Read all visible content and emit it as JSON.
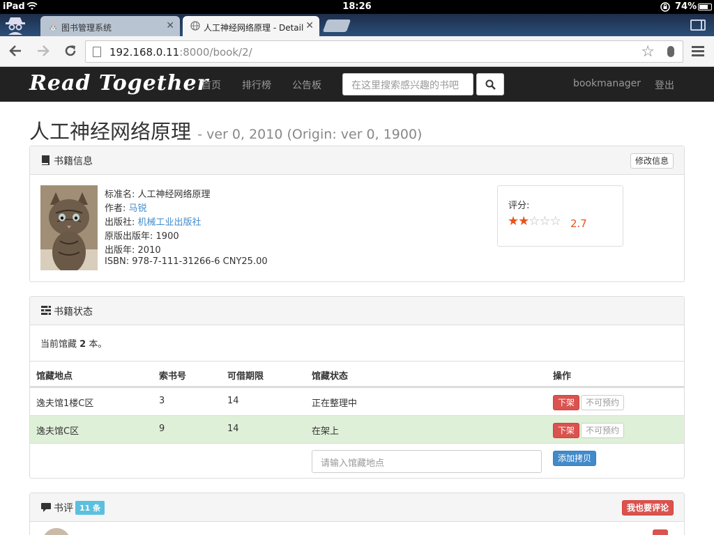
{
  "status_bar": {
    "carrier": "iPad",
    "time": "18:26",
    "battery": "74%"
  },
  "browser": {
    "tabs": [
      {
        "title": "图书管理系统",
        "active": false
      },
      {
        "title": "人工神经网络原理 - Detail",
        "active": true
      }
    ],
    "url_host": "192.168.0.11",
    "url_rest": ":8000/book/2/"
  },
  "navbar": {
    "brand": "Read Together",
    "links": [
      "首页",
      "排行榜",
      "公告板"
    ],
    "search_placeholder": "在这里搜索感兴趣的书吧",
    "user": "bookmanager",
    "logout": "登出"
  },
  "book": {
    "title": "人工神经网络原理",
    "version": "- ver 0, 2010 (Origin: ver 0, 1900)"
  },
  "info_panel": {
    "title": "书籍信息",
    "edit_button": "修改信息",
    "fields": {
      "std_name_label": "标准名:",
      "std_name": "人工神经网络原理",
      "author_label": "作者:",
      "author": "马锐",
      "publisher_label": "出版社:",
      "publisher": "机械工业出版社",
      "orig_year_label": "原版出版年:",
      "orig_year": "1900",
      "year_label": "出版年:",
      "year": "2010",
      "isbn_label": "ISBN:",
      "isbn": "978-7-111-31266-6 CNY25.00"
    },
    "rating_label": "评分:",
    "rating": 2.7,
    "rating_text": "2.7"
  },
  "status_panel": {
    "title": "书籍状态",
    "holding_prefix": "当前馆藏",
    "holding_count": "2",
    "holding_suffix": "本。",
    "columns": [
      "馆藏地点",
      "索书号",
      "可借期限",
      "馆藏状态",
      "操作"
    ],
    "rows": [
      {
        "location": "逸夫馆1楼C区",
        "call_no": "3",
        "period": "14",
        "status": "正在整理中",
        "action_down": "下架",
        "action_reserve": "不可预约"
      },
      {
        "location": "逸夫馆C区",
        "call_no": "9",
        "period": "14",
        "status": "在架上",
        "action_down": "下架",
        "action_reserve": "不可预约"
      }
    ],
    "add_placeholder": "请输入馆藏地点",
    "add_button": "添加拷贝"
  },
  "review_panel": {
    "title": "书评",
    "count_badge": "11 条",
    "write_button": "我也要评论"
  },
  "colors": {
    "navbar": "#222222",
    "danger": "#d9534f",
    "primary": "#428bca",
    "info": "#5bc0de",
    "star": "#e8531e"
  }
}
